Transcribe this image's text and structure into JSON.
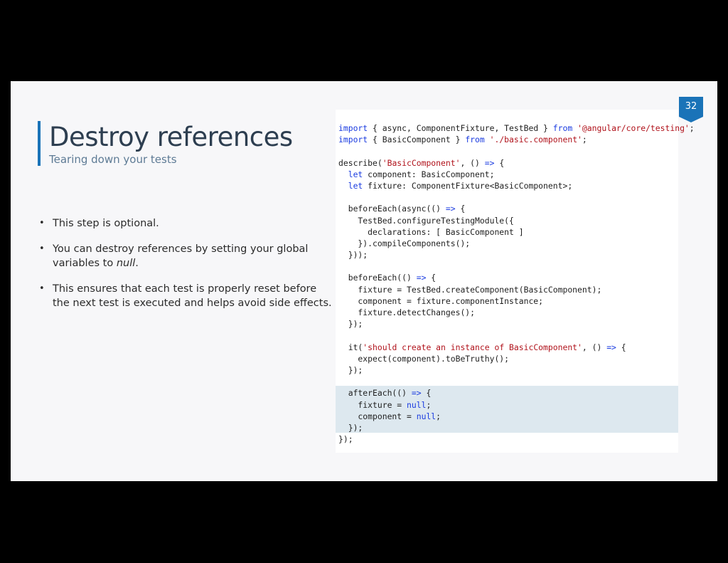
{
  "slide": {
    "title": "Destroy references",
    "subtitle": "Tearing down your tests",
    "page_number": "32",
    "accent_color": "#1a73b8",
    "bullets": [
      {
        "text": "This step is optional.",
        "emphasis": "",
        "suffix": ""
      },
      {
        "text": "You can destroy references by setting your global variables to ",
        "emphasis": "null",
        "suffix": "."
      },
      {
        "text": "This ensures that each test is properly reset before the next test is executed and helps avoid side effects.",
        "emphasis": "",
        "suffix": ""
      }
    ]
  },
  "code": {
    "language": "typescript",
    "highlighted_lines": [
      23,
      24,
      25,
      26
    ],
    "lines": [
      "import { async, ComponentFixture, TestBed } from '@angular/core/testing';",
      "import { BasicComponent } from './basic.component';",
      "",
      "describe('BasicComponent', () => {",
      "  let component: BasicComponent;",
      "  let fixture: ComponentFixture<BasicComponent>;",
      "",
      "  beforeEach(async(() => {",
      "    TestBed.configureTestingModule({",
      "      declarations: [ BasicComponent ]",
      "    }).compileComponents();",
      "  }));",
      "",
      "  beforeEach(() => {",
      "    fixture = TestBed.createComponent(BasicComponent);",
      "    component = fixture.componentInstance;",
      "    fixture.detectChanges();",
      "  });",
      "",
      "  it('should create an instance of BasicComponent', () => {",
      "    expect(component).toBeTruthy();",
      "  });",
      "",
      "  afterEach(() => {",
      "    fixture = null;",
      "    component = null;",
      "  });",
      "});"
    ]
  }
}
